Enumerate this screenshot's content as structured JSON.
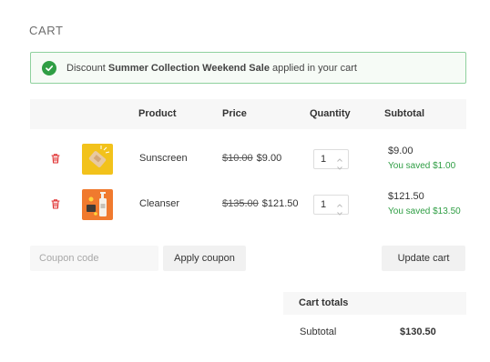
{
  "page": {
    "title": "CART"
  },
  "notice": {
    "prefix": "Discount ",
    "discount_name": "Summer Collection Weekend Sale",
    "suffix": " applied in your cart",
    "icon": "check-circle-icon",
    "color": "#2f9e44"
  },
  "table": {
    "headers": {
      "product": "Product",
      "price": "Price",
      "quantity": "Quantity",
      "subtotal": "Subtotal"
    },
    "rows": [
      {
        "name": "Sunscreen",
        "original_price": "$10.00",
        "price": "$9.00",
        "quantity": "1",
        "subtotal": "$9.00",
        "saved": "You saved $1.00",
        "remove_icon": "trash-icon",
        "thumbnail": "sunscreen-thumbnail"
      },
      {
        "name": "Cleanser",
        "original_price": "$135.00",
        "price": "$121.50",
        "quantity": "1",
        "subtotal": "$121.50",
        "saved": "You saved $13.50",
        "remove_icon": "trash-icon",
        "thumbnail": "cleanser-thumbnail"
      }
    ]
  },
  "coupon": {
    "placeholder": "Coupon code",
    "apply_label": "Apply coupon"
  },
  "update_label": "Update cart",
  "totals": {
    "heading": "Cart totals",
    "subtotal_label": "Subtotal",
    "subtotal_value": "$130.50"
  },
  "colors": {
    "accent_green": "#2f9e44",
    "remove_red": "#e03131",
    "panel_bg": "#f7f7f7"
  }
}
